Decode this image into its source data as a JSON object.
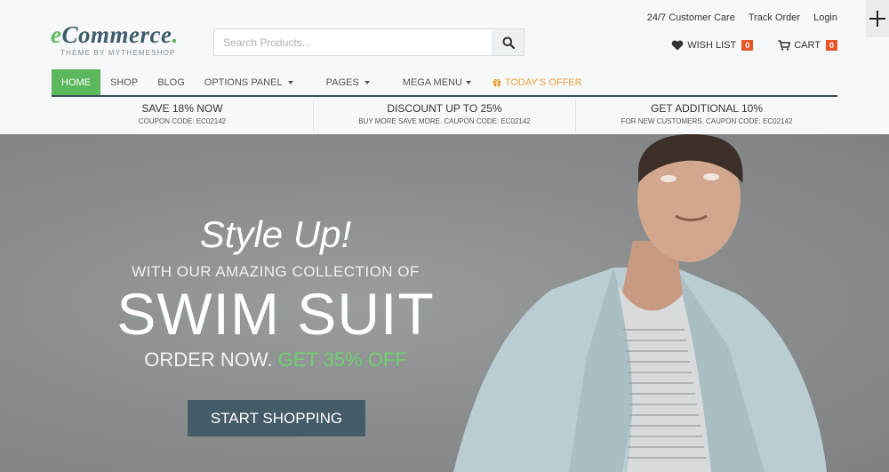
{
  "logo": {
    "brand_e": "e",
    "brand_rest": "Commerce",
    "brand_dot": ".",
    "tagline": "THEME BY MYTHEMESHOP"
  },
  "search": {
    "placeholder": "Search Products..."
  },
  "top_links": [
    "24/7 Customer Care",
    "Track Order",
    "Login"
  ],
  "wishlist": {
    "label": "WISH LIST",
    "count": "0"
  },
  "cart": {
    "label": "CART",
    "count": "0"
  },
  "nav": [
    {
      "label": "HOME",
      "active": true
    },
    {
      "label": "SHOP"
    },
    {
      "label": "BLOG"
    },
    {
      "label": "OPTIONS PANEL",
      "dropdown": true
    },
    {
      "label": "PAGES",
      "dropdown": true
    },
    {
      "label": "MEGA MENU",
      "dropdown": true
    },
    {
      "label": "TODAY'S OFFER",
      "icon": "gift-icon"
    }
  ],
  "coupons": [
    {
      "title": "SAVE 18% NOW",
      "subtitle": "COUPON CODE: EC02142"
    },
    {
      "title": "DISCOUNT UP TO 25%",
      "subtitle": "BUY MORE SAVE MORE. CAUPON CODE: EC02142"
    },
    {
      "title": "GET ADDITIONAL 10%",
      "subtitle": "FOR NEW CUSTOMERS. CAUPON CODE: EC02142"
    }
  ],
  "hero": {
    "line1": "Style Up!",
    "line2": "WITH OUR AMAZING COLLECTION OF",
    "line3": "SWIM SUIT",
    "line4": "ORDER NOW.",
    "line4_highlight": "GET 35% OFF",
    "cta": "START SHOPPING"
  },
  "colors": {
    "accent_green": "#5cb85c",
    "badge_orange": "#e8572a",
    "offer_orange": "#e8a23a",
    "cta_bg": "#445b68"
  },
  "icons": {
    "search": "search-icon",
    "wishlist": "heart-icon",
    "cart": "cart-icon",
    "corner": "plus-icon"
  }
}
